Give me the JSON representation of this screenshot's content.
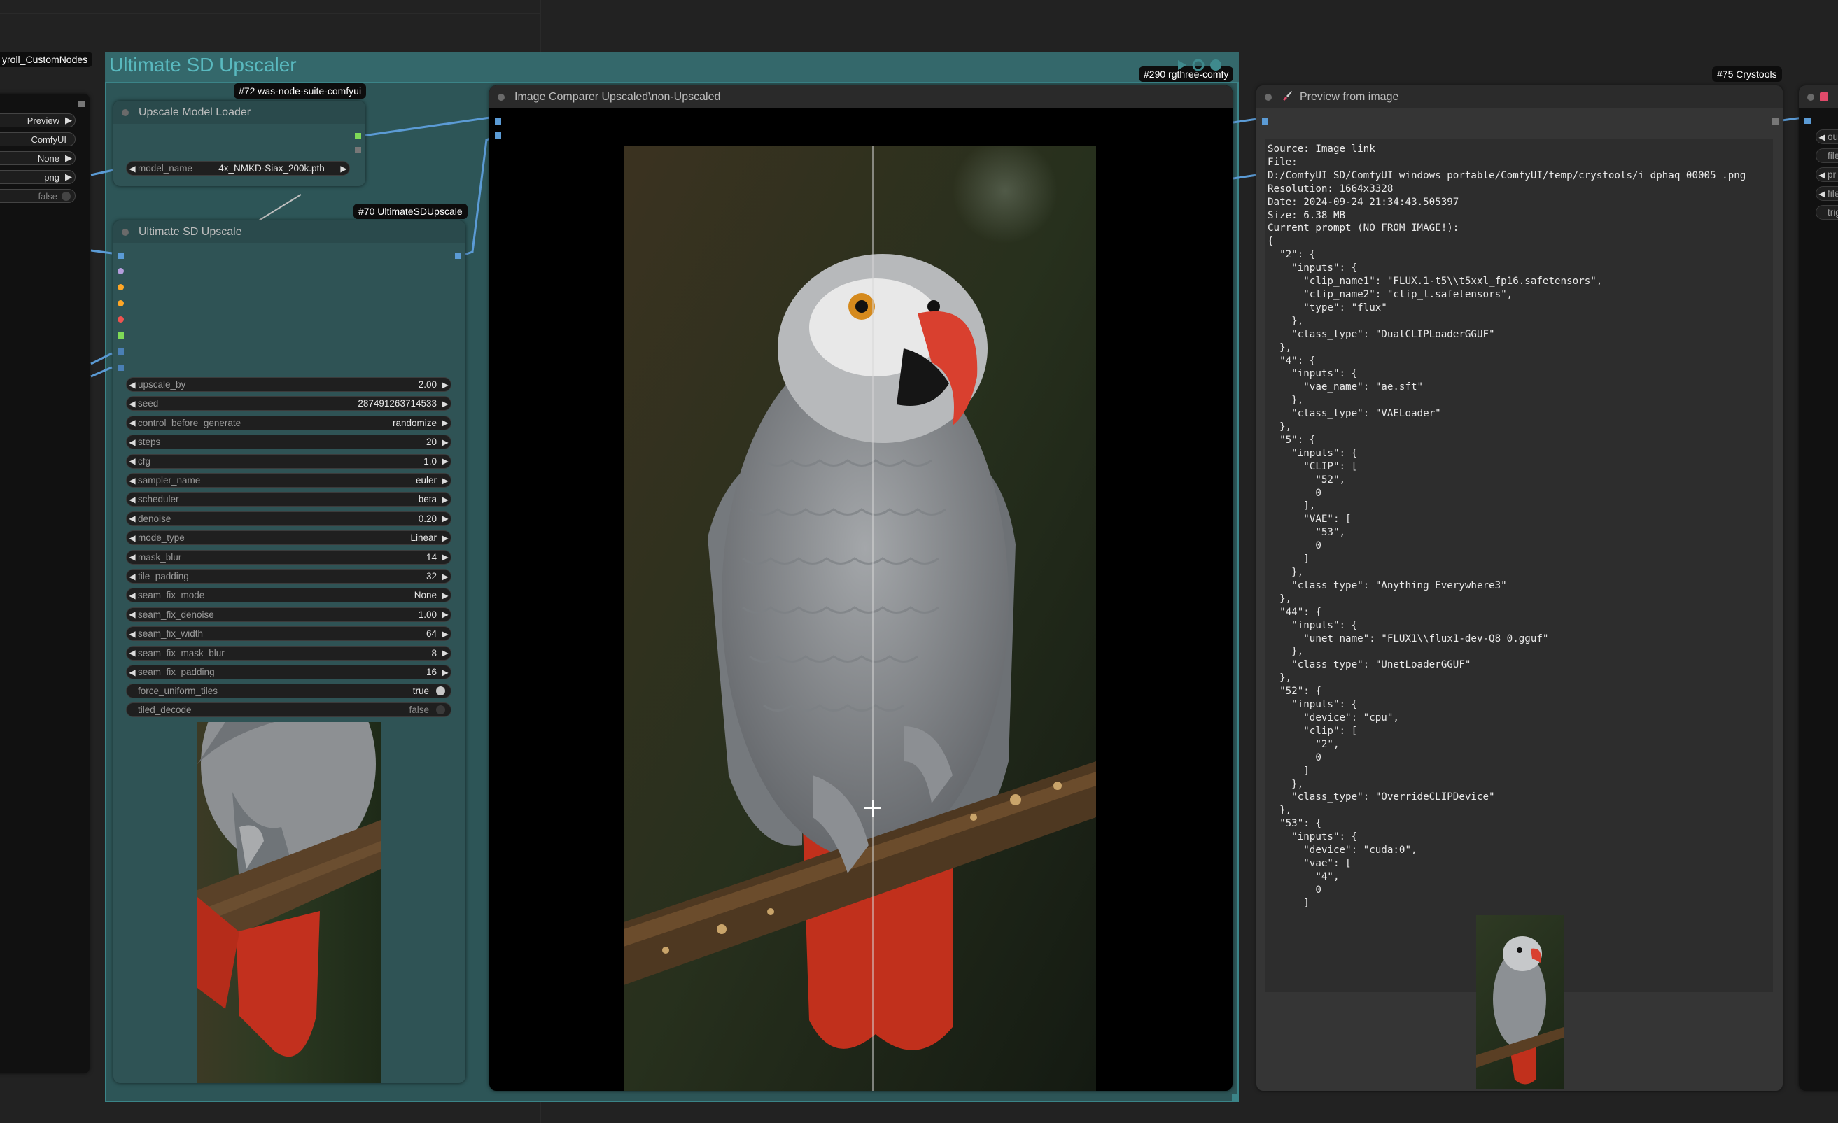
{
  "left_node": {
    "title": "yroll_CustomNodes",
    "widgets": [
      {
        "value": "Preview",
        "arrow": "▶"
      },
      {
        "value": "ComfyUI",
        "arrow": ""
      },
      {
        "value": "None",
        "arrow": "▶"
      },
      {
        "value": "png",
        "arrow": "▶"
      },
      {
        "value": "false",
        "arrow": ""
      }
    ]
  },
  "group": {
    "title": "Ultimate SD Upscaler",
    "color": "#2e6e70"
  },
  "loader_node": {
    "badge": "#72 was-node-suite-comfyui",
    "title": "Upscale Model Loader",
    "widget_label": "model_name",
    "widget_value": "4x_NMKD-Siax_200k.pth"
  },
  "upscale_node": {
    "badge": "#70 UltimateSDUpscale",
    "title": "Ultimate SD Upscale",
    "widgets": [
      {
        "label": "upscale_by",
        "value": "2.00"
      },
      {
        "label": "seed",
        "value": "287491263714533"
      },
      {
        "label": "control_before_generate",
        "value": "randomize"
      },
      {
        "label": "steps",
        "value": "20"
      },
      {
        "label": "cfg",
        "value": "1.0"
      },
      {
        "label": "sampler_name",
        "value": "euler"
      },
      {
        "label": "scheduler",
        "value": "beta"
      },
      {
        "label": "denoise",
        "value": "0.20"
      },
      {
        "label": "mode_type",
        "value": "Linear"
      },
      {
        "label": "mask_blur",
        "value": "14"
      },
      {
        "label": "tile_padding",
        "value": "32"
      },
      {
        "label": "seam_fix_mode",
        "value": "None"
      },
      {
        "label": "seam_fix_denoise",
        "value": "1.00"
      },
      {
        "label": "seam_fix_width",
        "value": "64"
      },
      {
        "label": "seam_fix_mask_blur",
        "value": "8"
      },
      {
        "label": "seam_fix_padding",
        "value": "16"
      }
    ],
    "toggles": [
      {
        "label": "force_uniform_tiles",
        "value": "true",
        "on": true
      },
      {
        "label": "tiled_decode",
        "value": "false",
        "on": false
      }
    ]
  },
  "comparer_node": {
    "badge": "#290 rgthree-comfy",
    "title": "Image Comparer Upscaled\\non-Upscaled"
  },
  "preview_node": {
    "badge": "#75 Crystools",
    "title": "Preview from image",
    "info_text": "Source: Image link\nFile:\nD:/ComfyUI_SD/ComfyUI_windows_portable/ComfyUI/temp/crystools/i_dphaq_00005_.png\nResolution: 1664x3328\nDate: 2024-09-24 21:34:43.505397\nSize: 6.38 MB\nCurrent prompt (NO FROM IMAGE!):\n{\n  \"2\": {\n    \"inputs\": {\n      \"clip_name1\": \"FLUX.1-t5\\\\t5xxl_fp16.safetensors\",\n      \"clip_name2\": \"clip_l.safetensors\",\n      \"type\": \"flux\"\n    },\n    \"class_type\": \"DualCLIPLoaderGGUF\"\n  },\n  \"4\": {\n    \"inputs\": {\n      \"vae_name\": \"ae.sft\"\n    },\n    \"class_type\": \"VAELoader\"\n  },\n  \"5\": {\n    \"inputs\": {\n      \"CLIP\": [\n        \"52\",\n        0\n      ],\n      \"VAE\": [\n        \"53\",\n        0\n      ]\n    },\n    \"class_type\": \"Anything Everywhere3\"\n  },\n  \"44\": {\n    \"inputs\": {\n      \"unet_name\": \"FLUX1\\\\flux1-dev-Q8_0.gguf\"\n    },\n    \"class_type\": \"UnetLoaderGGUF\"\n  },\n  \"52\": {\n    \"inputs\": {\n      \"device\": \"cpu\",\n      \"clip\": [\n        \"2\",\n        0\n      ]\n    },\n    \"class_type\": \"OverrideCLIPDevice\"\n  },\n  \"53\": {\n    \"inputs\": {\n      \"device\": \"cuda:0\",\n      \"vae\": [\n        \"4\",\n        0\n      ]"
  },
  "right_node": {
    "items": [
      "ou",
      "files",
      "pr",
      "file",
      "trig"
    ]
  },
  "icons": {
    "preview_title_icon": "paintbrush-icon",
    "right_title_icon": "save-icon"
  }
}
